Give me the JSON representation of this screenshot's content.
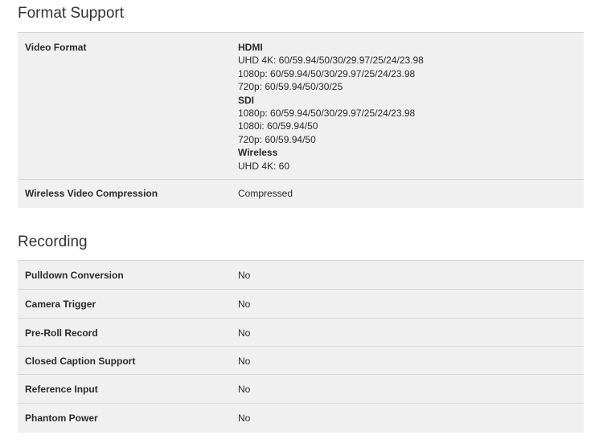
{
  "format_support": {
    "title": "Format Support",
    "rows": {
      "video_format": {
        "label": "Video Format",
        "groups": [
          {
            "heading": "HDMI",
            "lines": [
              "UHD 4K: 60/59.94/50/30/29.97/25/24/23.98",
              "1080p: 60/59.94/50/30/29.97/25/24/23.98",
              "720p: 60/59.94/50/30/25"
            ]
          },
          {
            "heading": "SDI",
            "lines": [
              "1080p: 60/59.94/50/30/29.97/25/24/23.98",
              "1080i: 60/59.94/50",
              "720p: 60/59.94/50"
            ]
          },
          {
            "heading": "Wireless",
            "lines": [
              "UHD 4K: 60"
            ]
          }
        ]
      },
      "wireless_video_compression": {
        "label": "Wireless Video Compression",
        "value": "Compressed"
      }
    }
  },
  "recording": {
    "title": "Recording",
    "rows": [
      {
        "label": "Pulldown Conversion",
        "value": "No"
      },
      {
        "label": "Camera Trigger",
        "value": "No"
      },
      {
        "label": "Pre-Roll Record",
        "value": "No"
      },
      {
        "label": "Closed Caption Support",
        "value": "No"
      },
      {
        "label": "Reference Input",
        "value": "No"
      },
      {
        "label": "Phantom Power",
        "value": "No"
      }
    ]
  }
}
